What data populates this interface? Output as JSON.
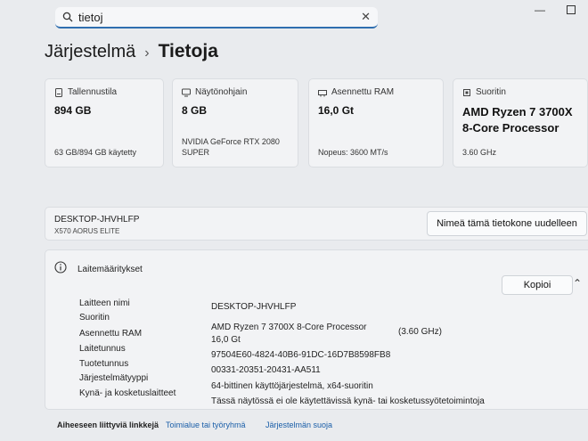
{
  "search": {
    "value": "tietoj",
    "clear_glyph": "✕"
  },
  "window": {
    "minimize_glyph": "—"
  },
  "breadcrumb": {
    "parent": "Järjestelmä",
    "separator": "›",
    "current": "Tietoja"
  },
  "cards": [
    {
      "icon": "storage-icon",
      "label": "Tallennustila",
      "value": "894 GB",
      "sub": "63 GB/894 GB käytetty"
    },
    {
      "icon": "display-icon",
      "label": "Näytönohjain",
      "value": "8 GB",
      "sub": "NVIDIA GeForce RTX 2080 SUPER"
    },
    {
      "icon": "memory-icon",
      "label": "Asennettu RAM",
      "value": "16,0 Gt",
      "sub": "Nopeus: 3600 MT/s"
    },
    {
      "icon": "processor-icon",
      "label": "Suoritin",
      "value": "AMD Ryzen 7 3700X 8-Core Processor",
      "sub": "3.60 GHz"
    }
  ],
  "device": {
    "name": "DESKTOP-JHVHLFP",
    "model": "X570 AORUS ELITE",
    "rename_label": "Nimeä tämä tietokone uudelleen"
  },
  "specs": {
    "title": "Laitemääritykset",
    "copy_label": "Kopioi",
    "collapse_glyph": "⌃",
    "rows": [
      {
        "label": "Laitteen nimi",
        "value": "DESKTOP-JHVHLFP",
        "extra": ""
      },
      {
        "label": "Suoritin",
        "value": "AMD Ryzen 7 3700X 8-Core Processor",
        "extra": "(3.60 GHz)"
      },
      {
        "label": "Asennettu RAM",
        "value": "16,0 Gt",
        "extra": ""
      },
      {
        "label": "Laitetunnus",
        "value": "97504E60-4824-40B6-91DC-16D7B8598FB8",
        "extra": ""
      },
      {
        "label": "Tuotetunnus",
        "value": "00331-20351-20431-AA511",
        "extra": ""
      },
      {
        "label": "Järjestelmätyyppi",
        "value": "64-bittinen käyttöjärjestelmä, x64-suoritin",
        "extra": ""
      },
      {
        "label": "Kynä- ja kosketuslaitteet",
        "value": "Tässä näytössä ei ole käytettävissä kynä- tai kosketussyötetoimintoja",
        "extra": ""
      }
    ]
  },
  "related": {
    "label": "Aiheeseen liittyviä linkkejä",
    "link1": "Toimialue tai työryhmä",
    "link2": "Järjestelmän suoja"
  }
}
